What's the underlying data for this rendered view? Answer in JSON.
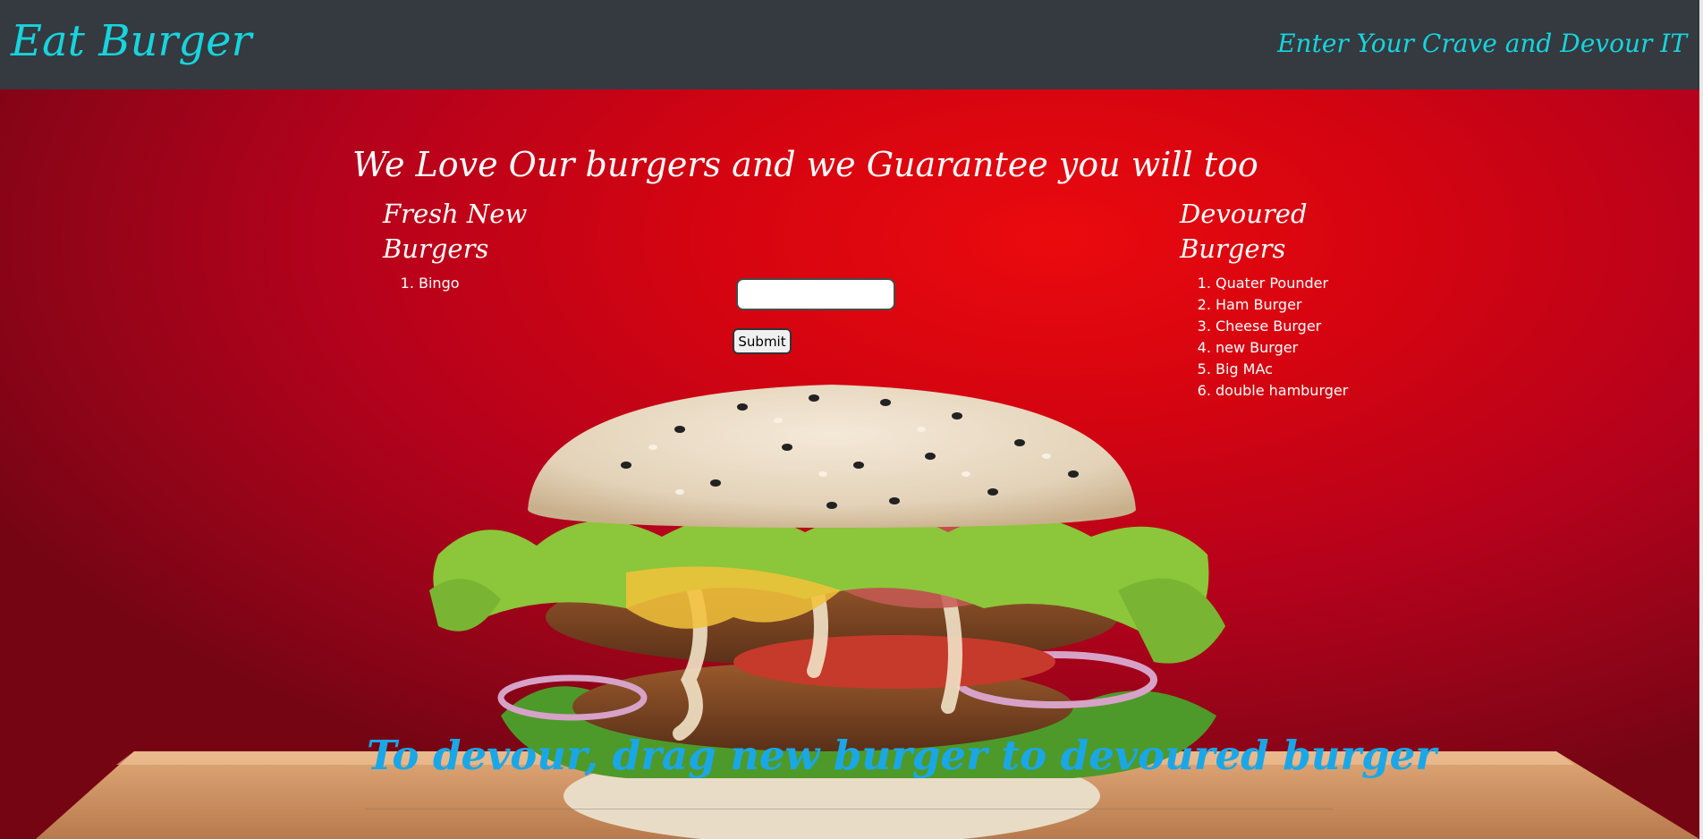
{
  "navbar": {
    "brand": "Eat Burger",
    "tagline": "Enter Your Crave and Devour IT",
    "background": "#343a40",
    "accent": "#17d4dd"
  },
  "main": {
    "headline": "We Love Our burgers and we Guarantee you will too",
    "fresh": {
      "title": "Fresh New Burgers",
      "items": [
        "Bingo"
      ]
    },
    "form": {
      "input_value": "",
      "submit_label": "Submit"
    },
    "devoured": {
      "title": "Devoured Burgers",
      "items": [
        "Quater Pounder",
        "Ham Burger",
        "Cheese Burger",
        "new Burger",
        "Big MAc",
        "double hamburger"
      ]
    },
    "instructions": "To devour, drag new burger to devoured burger",
    "instructions_color": "#1aa7e8"
  }
}
